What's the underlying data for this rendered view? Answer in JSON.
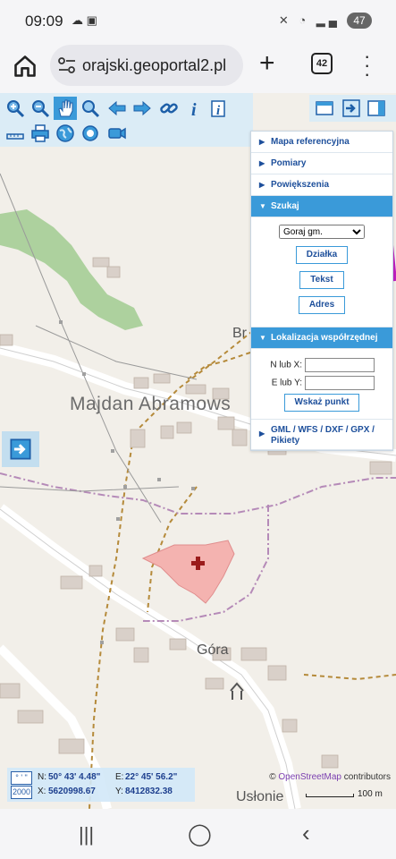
{
  "status": {
    "time": "09:09",
    "battery": "47"
  },
  "browser": {
    "url": "orajski.geoportal2.pl",
    "tab_count": "42"
  },
  "panel": {
    "sections": [
      {
        "label": "Mapa referencyjna",
        "expanded": false
      },
      {
        "label": "Pomiary",
        "expanded": false
      },
      {
        "label": "Powiększenia",
        "expanded": false
      }
    ],
    "search": {
      "label": "Szukaj",
      "select_value": "Goraj gm.",
      "btn_dzialka": "Działka",
      "btn_tekst": "Tekst",
      "btn_adres": "Adres"
    },
    "coords_section": {
      "label": "Lokalizacja współrzędnej",
      "n_label": "N lub X:",
      "e_label": "E lub Y:",
      "show_button": "Wskaż punkt"
    },
    "export_label": "GML / WFS / DXF / GPX / Pikiety"
  },
  "map": {
    "labels": {
      "village": "Majdan Abramows",
      "br": "Br",
      "gora": "Góra",
      "uslonie": "Usłonie"
    },
    "coords": {
      "format_btn": "° ' \"",
      "epsg_btn": "2000",
      "n_label": "N:",
      "n_value": "50° 43' 4.48\"",
      "e_label": "E:",
      "e_value": "22° 45' 56.2\"",
      "x_label": "X:",
      "x_value": "5620998.67",
      "y_label": "Y:",
      "y_value": "8412832.38"
    },
    "attribution": {
      "copy": "©",
      "osm": "OpenStreetMap",
      "rest": "contributors"
    },
    "scale": "100 m"
  }
}
